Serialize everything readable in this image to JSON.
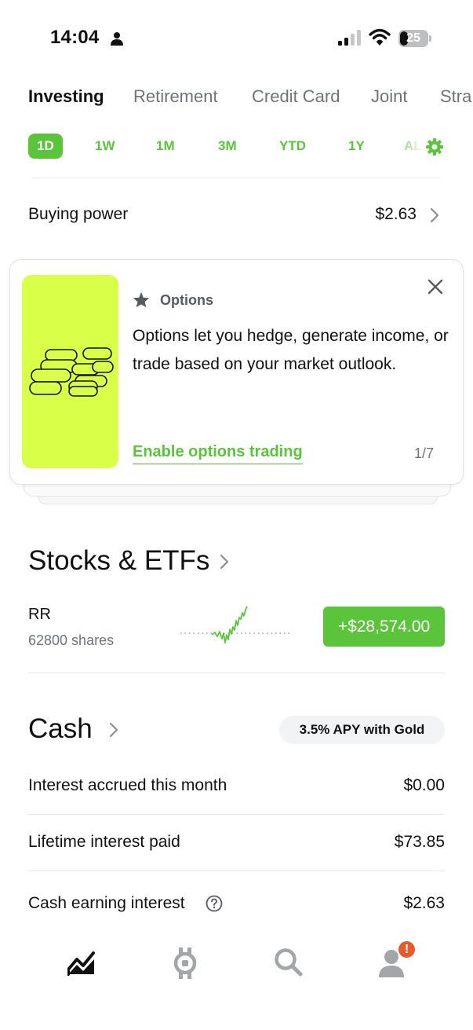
{
  "status_bar": {
    "time": "14:04",
    "battery": "25"
  },
  "account_tabs": [
    "Investing",
    "Retirement",
    "Credit Card",
    "Joint",
    "Stra"
  ],
  "range_tabs": [
    "1D",
    "1W",
    "1M",
    "3M",
    "YTD",
    "1Y",
    "AL"
  ],
  "buying_power": {
    "label": "Buying power",
    "value": "$2.63"
  },
  "options_card": {
    "kicker": "Options",
    "body": "Options let you hedge, generate income, or trade based on your market outlook.",
    "cta": "Enable options trading",
    "page": "1/7"
  },
  "stocks": {
    "title": "Stocks & ETFs",
    "ticker": "RR",
    "shares": "62800 shares",
    "change": "+$28,574.00"
  },
  "cash": {
    "title": "Cash",
    "pill": "3.5% APY with Gold",
    "rows": [
      {
        "label": "Interest accrued this month",
        "value": "$0.00"
      },
      {
        "label": "Lifetime interest paid",
        "value": "$73.85"
      },
      {
        "label": "Cash earning interest",
        "value": "$2.63"
      }
    ]
  },
  "nav": {
    "badge": "!"
  },
  "colors": {
    "accent": "#5ac53b",
    "card_illustration": "#d9ff48",
    "badge": "#e65b2e"
  }
}
